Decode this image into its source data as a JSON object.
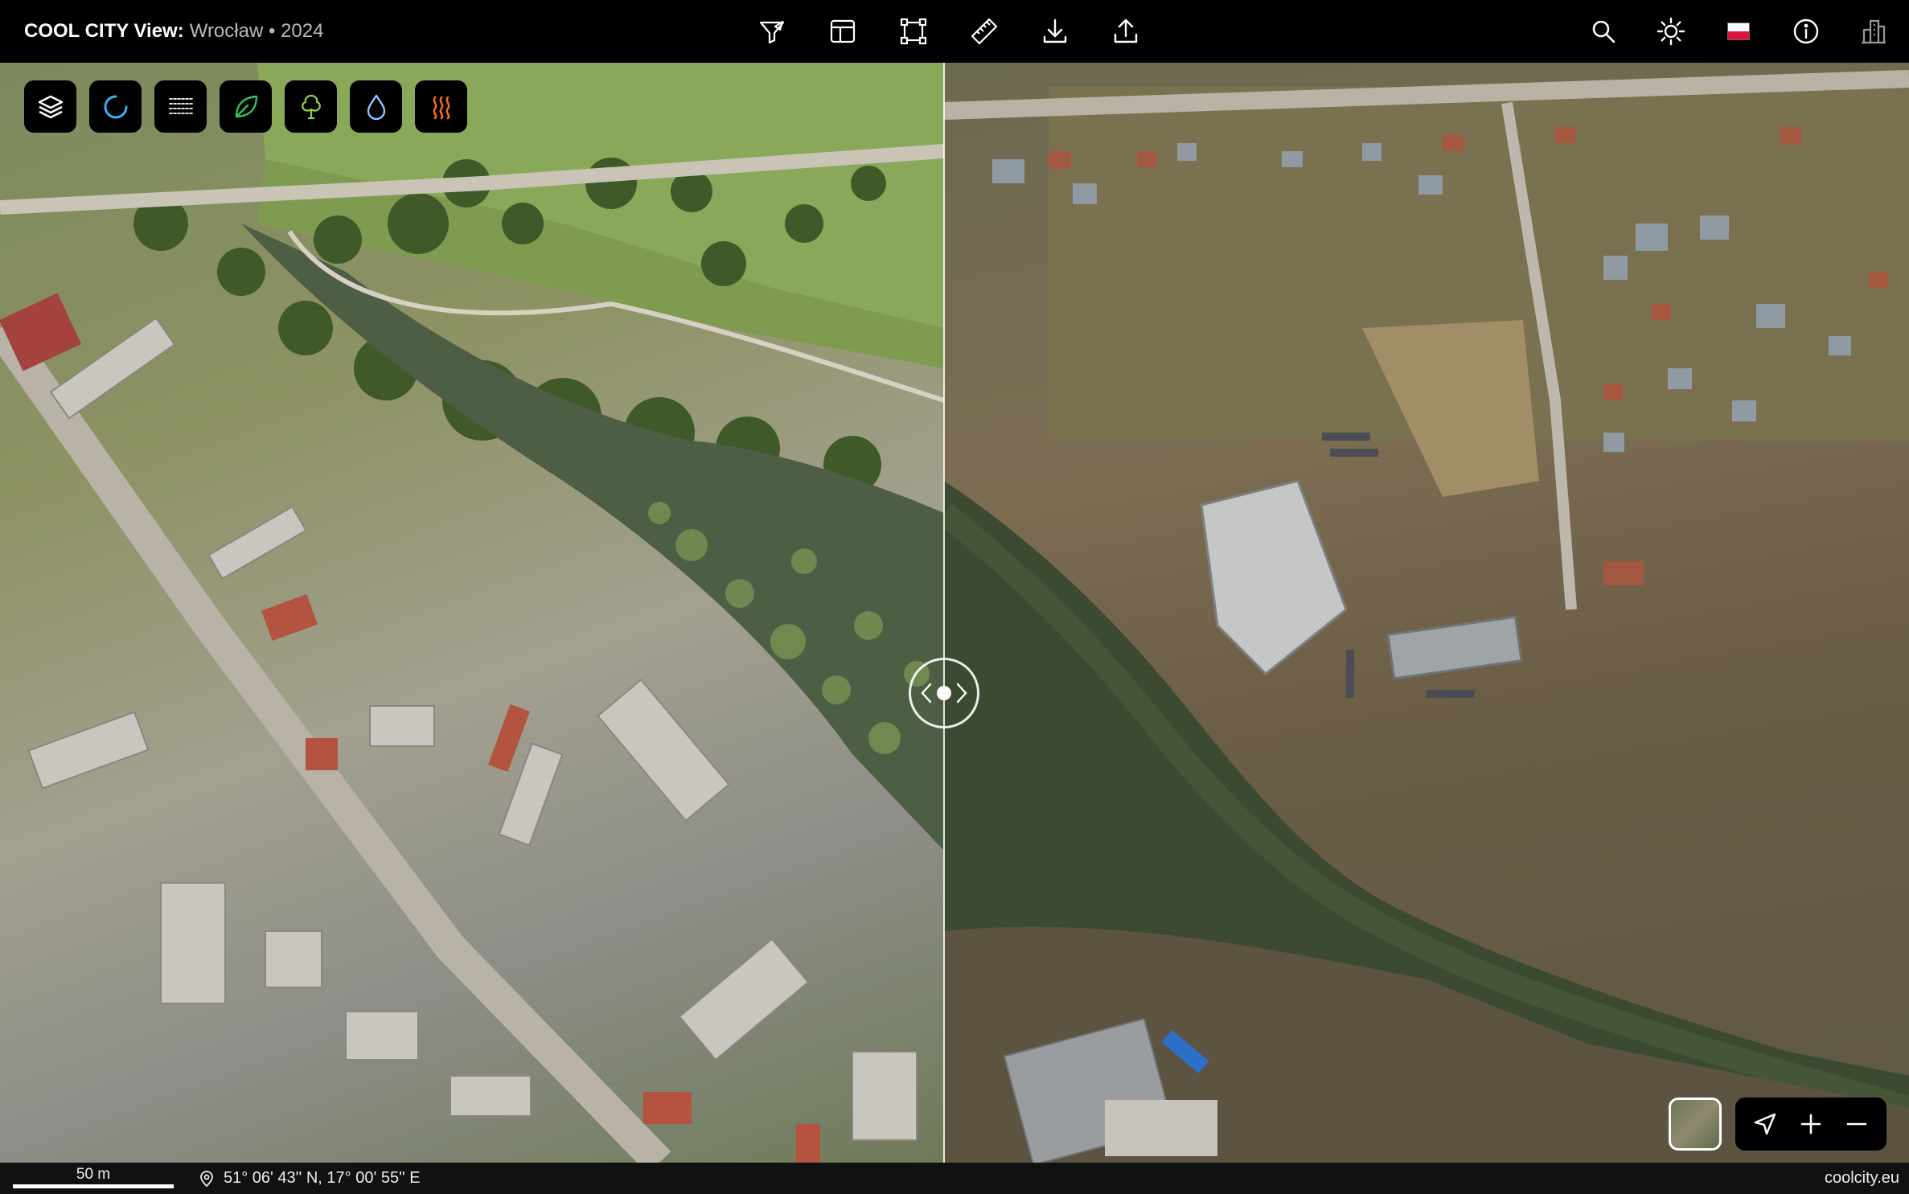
{
  "header": {
    "brand": "COOL CITY View:",
    "place": "Wrocław • 2024"
  },
  "toolbar_center": [
    {
      "icon": "filter-icon"
    },
    {
      "icon": "layout-icon"
    },
    {
      "icon": "select-area-icon"
    },
    {
      "icon": "ruler-icon"
    },
    {
      "icon": "download-icon"
    },
    {
      "icon": "share-icon"
    }
  ],
  "toolbar_right": [
    {
      "icon": "search-icon"
    },
    {
      "icon": "sun-icon"
    },
    {
      "icon": "poland-flag-icon"
    },
    {
      "icon": "info-icon"
    },
    {
      "icon": "city-buildings-icon"
    }
  ],
  "layer_buttons": [
    {
      "icon": "layers-icon",
      "color": "#ffffff"
    },
    {
      "icon": "loading-spinner-icon",
      "color": "#34b4f0"
    },
    {
      "icon": "hatching-lines-icon",
      "color": "#ffffff"
    },
    {
      "icon": "leaf-icon",
      "color": "#35c05a"
    },
    {
      "icon": "tree-icon",
      "color": "#8fd14f"
    },
    {
      "icon": "water-drop-icon",
      "color": "#8fc8ff"
    },
    {
      "icon": "heat-waves-icon",
      "color": "#f26a2a"
    }
  ],
  "map": {
    "left_label": "aerial-2024-summer",
    "right_label": "aerial-winter",
    "split_handle": "compare-slider"
  },
  "controls": {
    "basemap": "basemap-thumbnail",
    "locate": "location-arrow-icon",
    "zoom_in": "+",
    "zoom_out": "−"
  },
  "footer": {
    "scale": "50 m",
    "coordinates": "51° 06' 43'' N, 17° 00' 55'' E",
    "site": "coolcity.eu"
  }
}
